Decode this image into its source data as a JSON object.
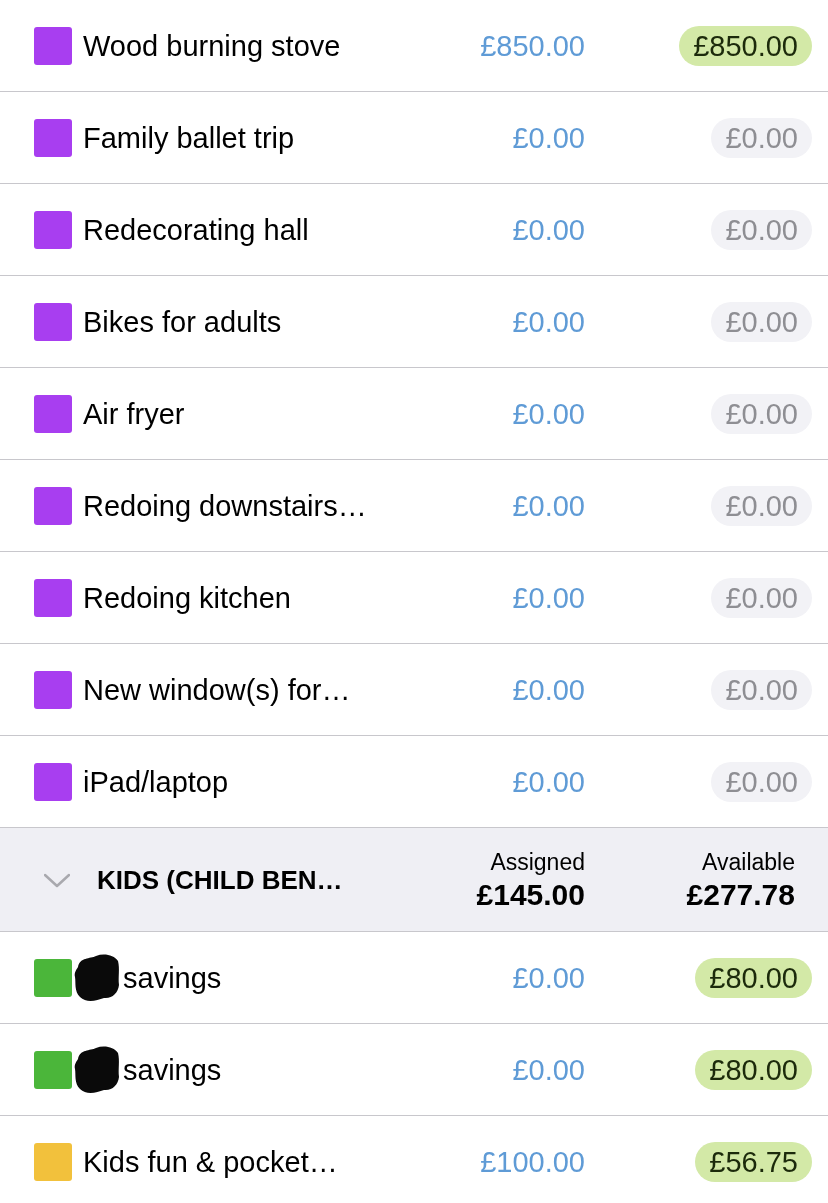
{
  "categories": [
    {
      "color": "#a83ef0",
      "name": "Wood burning stove",
      "assigned": "£850.00",
      "available": "£850.00",
      "funded": true
    },
    {
      "color": "#a83ef0",
      "name": "Family ballet trip",
      "assigned": "£0.00",
      "available": "£0.00",
      "funded": false
    },
    {
      "color": "#a83ef0",
      "name": "Redecorating hall",
      "assigned": "£0.00",
      "available": "£0.00",
      "funded": false
    },
    {
      "color": "#a83ef0",
      "name": "Bikes for adults",
      "assigned": "£0.00",
      "available": "£0.00",
      "funded": false
    },
    {
      "color": "#a83ef0",
      "name": "Air fryer",
      "assigned": "£0.00",
      "available": "£0.00",
      "funded": false
    },
    {
      "color": "#a83ef0",
      "name": "Redoing downstairs…",
      "assigned": "£0.00",
      "available": "£0.00",
      "funded": false
    },
    {
      "color": "#a83ef0",
      "name": "Redoing kitchen",
      "assigned": "£0.00",
      "available": "£0.00",
      "funded": false
    },
    {
      "color": "#a83ef0",
      "name": "New window(s) for…",
      "assigned": "£0.00",
      "available": "£0.00",
      "funded": false
    },
    {
      "color": "#a83ef0",
      "name": "iPad/laptop",
      "assigned": "£0.00",
      "available": "£0.00",
      "funded": false
    }
  ],
  "group": {
    "name": "KIDS (CHILD BEN…",
    "expanded": true,
    "assigned_label": "Assigned",
    "assigned": "£145.00",
    "available_label": "Available",
    "available": "£277.78",
    "categories": [
      {
        "color": "#4bb63a",
        "redacted": true,
        "name": "savings",
        "assigned": "£0.00",
        "available": "£80.00",
        "funded": true
      },
      {
        "color": "#4bb63a",
        "redacted": true,
        "name": "savings",
        "assigned": "£0.00",
        "available": "£80.00",
        "funded": true
      },
      {
        "color": "#f2c13c",
        "redacted": false,
        "name": "Kids fun & pocket…",
        "assigned": "£100.00",
        "available": "£56.75",
        "funded": true
      }
    ]
  }
}
